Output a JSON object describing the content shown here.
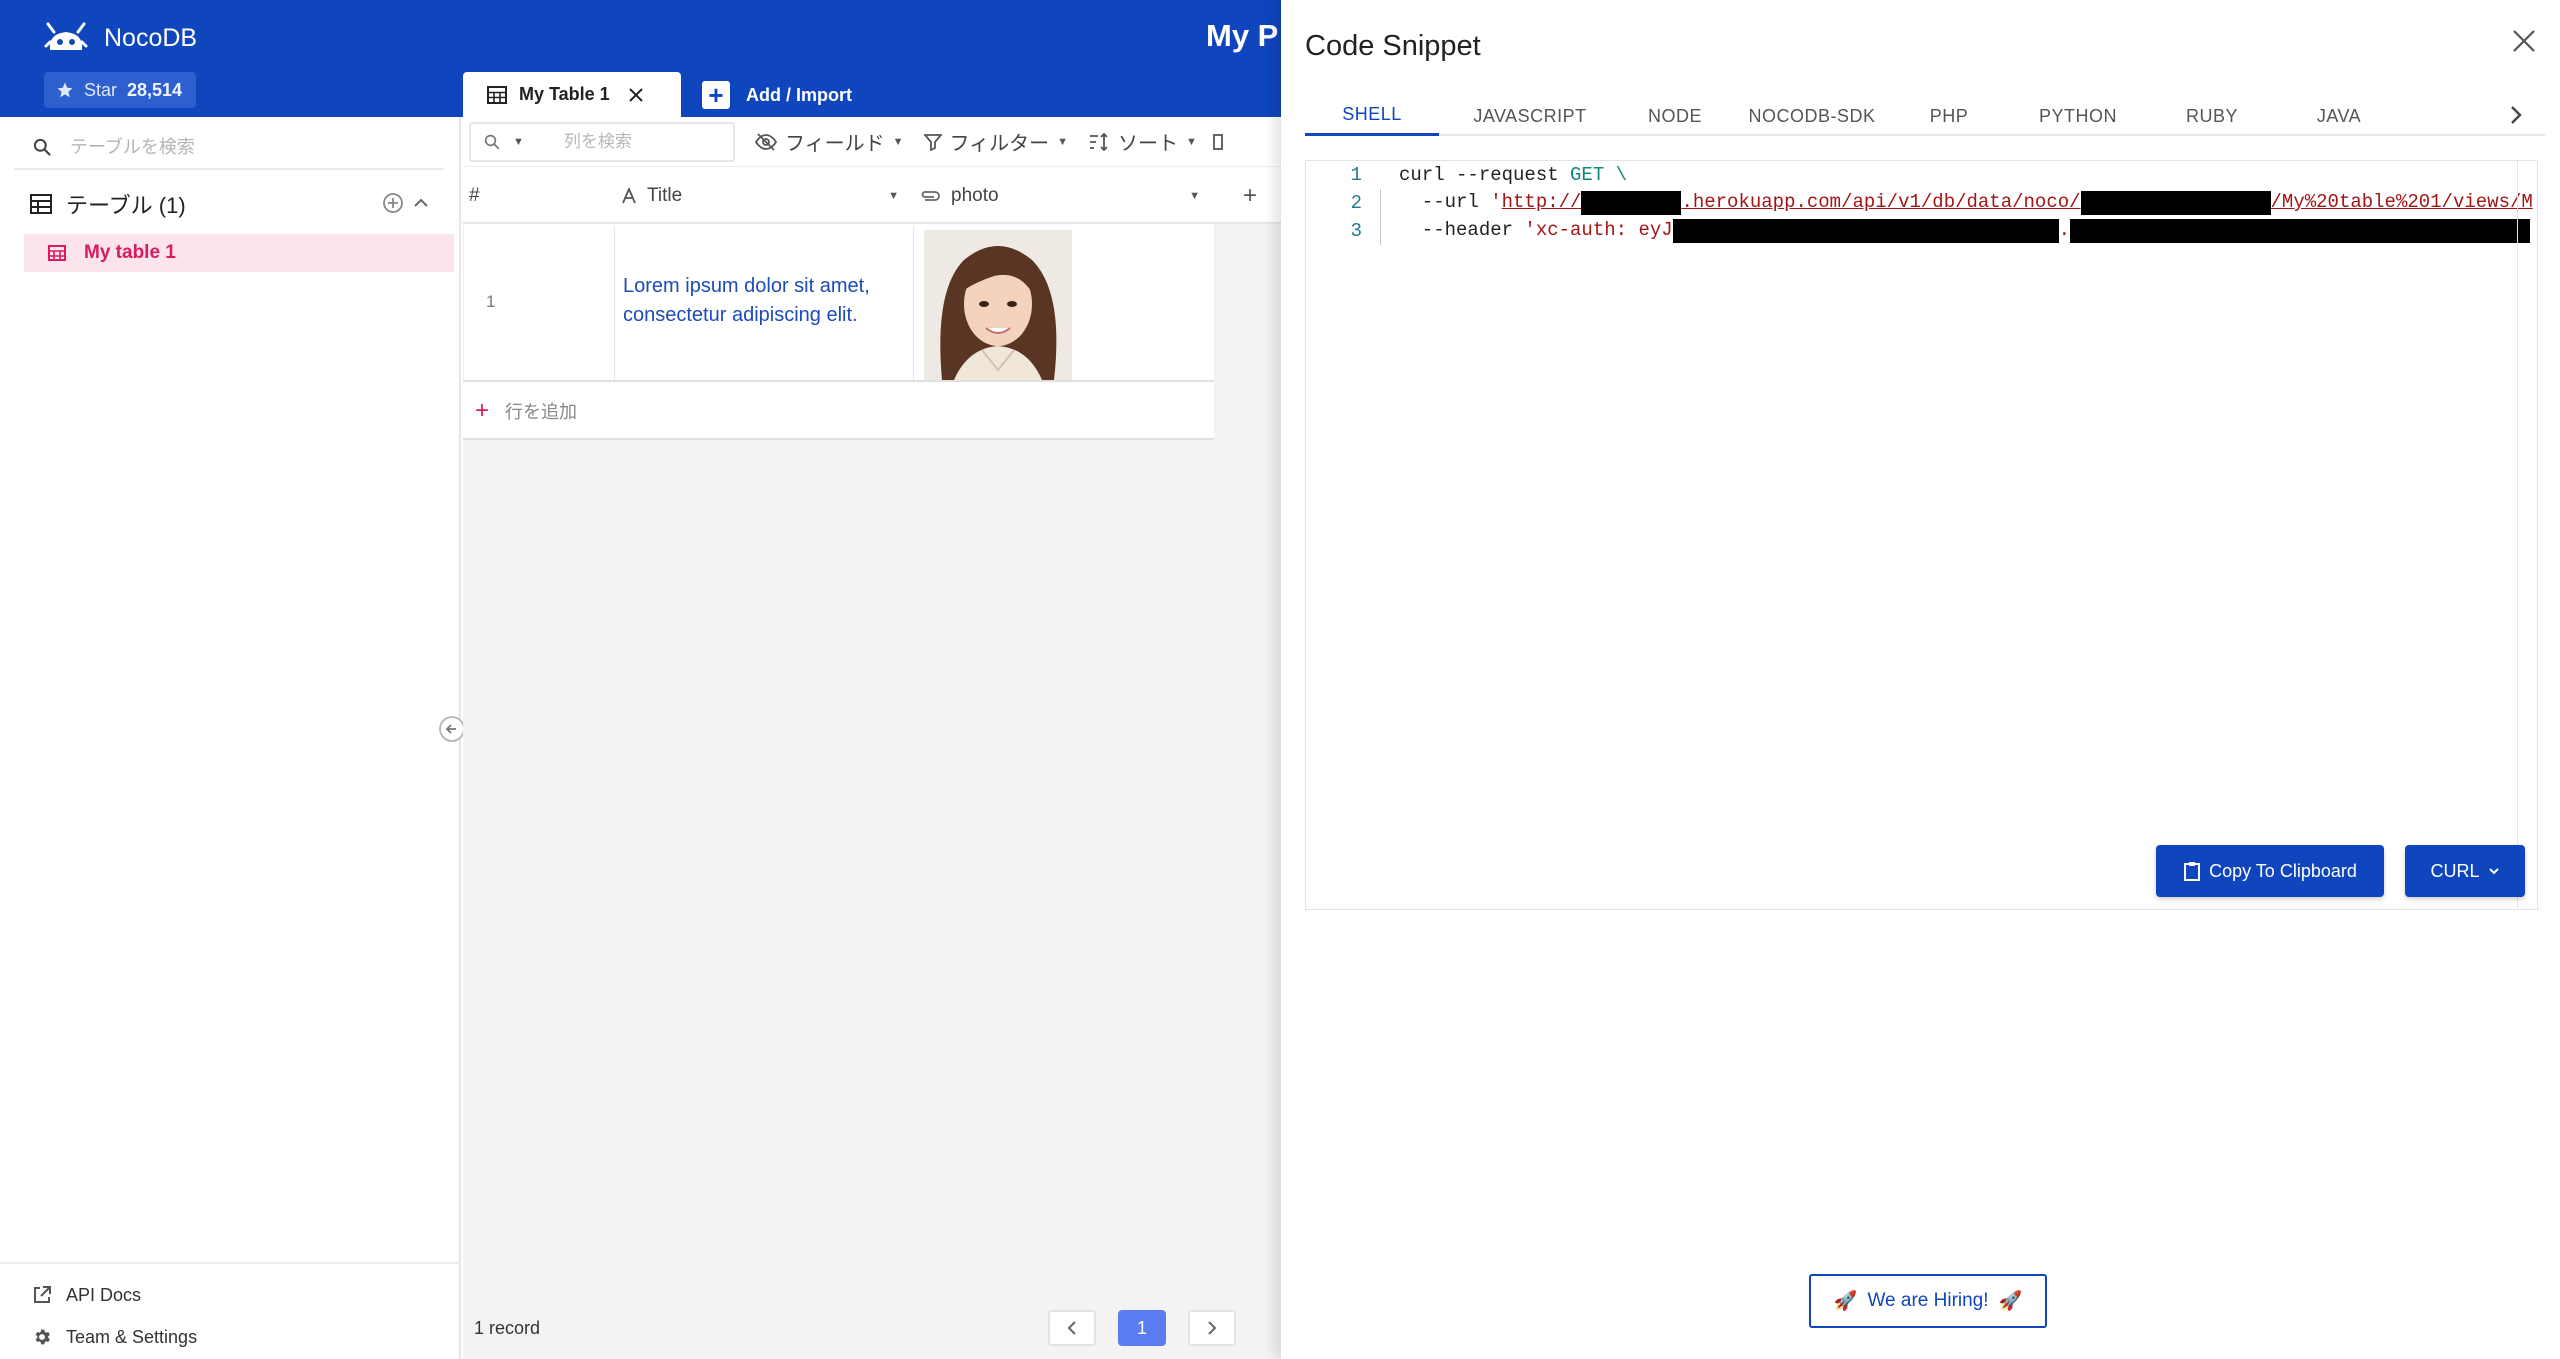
{
  "sidebar": {
    "brand": "NocoDB",
    "star_label": "Star",
    "star_count": "28,514",
    "search_placeholder": "テーブルを検索",
    "tables_heading": "テーブル (1)",
    "tables": [
      {
        "label": "My table 1"
      }
    ],
    "footer": [
      {
        "label": "API Docs"
      },
      {
        "label": "Team & Settings"
      }
    ]
  },
  "header": {
    "project_title": "My P",
    "tabs": [
      {
        "label": "My Table 1"
      }
    ],
    "add_import_label": "Add / Import"
  },
  "toolbar": {
    "column_search_placeholder": "列を検索",
    "fields_label": "フィールド",
    "filter_label": "フィルター",
    "sort_label": "ソート"
  },
  "grid": {
    "columns": [
      {
        "label": "#"
      },
      {
        "label": "Title"
      },
      {
        "label": "photo"
      }
    ],
    "rows": [
      {
        "num": "1",
        "title": "Lorem ipsum dolor sit amet, consectetur adipiscing elit."
      }
    ],
    "add_row_label": "行を追加",
    "record_count": "1 record",
    "current_page": "1"
  },
  "drawer": {
    "title": "Code Snippet",
    "tabs": [
      {
        "label": "SHELL"
      },
      {
        "label": "JAVASCRIPT"
      },
      {
        "label": "NODE"
      },
      {
        "label": "NOCODB-SDK"
      },
      {
        "label": "PHP"
      },
      {
        "label": "PYTHON"
      },
      {
        "label": "RUBY"
      },
      {
        "label": "JAVA"
      }
    ],
    "active_tab": "SHELL",
    "code": {
      "line1_num": "1",
      "line2_num": "2",
      "line3_num": "3",
      "l1_cmd": "curl --request ",
      "l1_method": "GET",
      "l1_cont": " \\",
      "l2_flag": "  --url ",
      "l2_q": "'",
      "l2_proto": "http://",
      "l2_host": ".herokuapp.com/api/v1/db/data/noco/",
      "l2_path": "/My%20table%201/views/M",
      "l3_flag": "  --header ",
      "l3_str": "'xc-auth: eyJ",
      "l3_dot": "."
    },
    "copy_label": "Copy To Clipboard",
    "format_label": "CURL",
    "hiring_label": "We are Hiring!",
    "hiring_emoji": "🚀"
  },
  "colors": {
    "brand_blue": "#0f45bd",
    "accent_pink": "#d81b60",
    "page_blue": "#5b7cf0"
  }
}
